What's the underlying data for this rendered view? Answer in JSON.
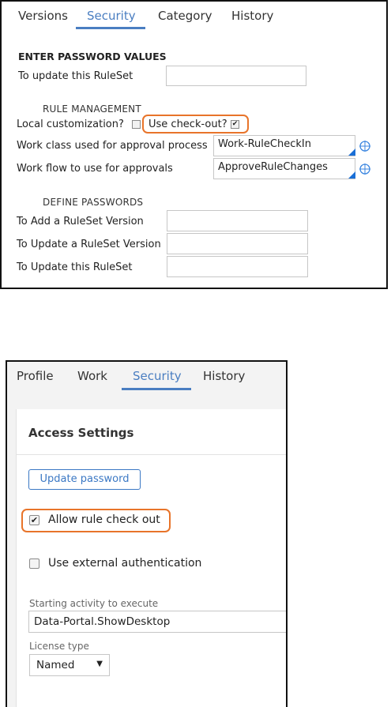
{
  "ruleset_panel": {
    "tabs": [
      {
        "label": "Versions"
      },
      {
        "label": "Security"
      },
      {
        "label": "Category"
      },
      {
        "label": "History"
      }
    ],
    "active_tab": "Security",
    "enter_password_heading": "ENTER PASSWORD VALUES",
    "update_ruleset_label": "To update this RuleSet",
    "update_ruleset_value": "",
    "rule_management_heading": "RULE MANAGEMENT",
    "local_customization_label": "Local customization?",
    "local_customization_checked": false,
    "use_checkout_label": "Use check-out?",
    "use_checkout_checked": true,
    "work_class_label": "Work class used for approval process",
    "work_class_value": "Work-RuleCheckIn",
    "work_flow_label": "Work flow to use for approvals",
    "work_flow_value": "ApproveRuleChanges",
    "define_passwords_heading": "DEFINE PASSWORDS",
    "add_version_label": "To Add a RuleSet Version",
    "update_version_label": "To Update a RuleSet Version",
    "update_this_label": "To Update this RuleSet",
    "highlight_color": "#e8742a",
    "accent_color": "#4a7ec1"
  },
  "operator_panel": {
    "tabs": [
      {
        "label": "Profile"
      },
      {
        "label": "Work"
      },
      {
        "label": "Security"
      },
      {
        "label": "History"
      }
    ],
    "active_tab": "Security",
    "section_title": "Access Settings",
    "update_password_button": "Update password",
    "allow_checkout_label": "Allow rule check out",
    "allow_checkout_checked": true,
    "external_auth_label": "Use external authentication",
    "external_auth_checked": false,
    "starting_activity_label": "Starting activity to execute",
    "starting_activity_value": "Data-Portal.ShowDesktop",
    "license_type_label": "License type",
    "license_type_value": "Named",
    "dropdown_icon": "caret-down-icon"
  }
}
